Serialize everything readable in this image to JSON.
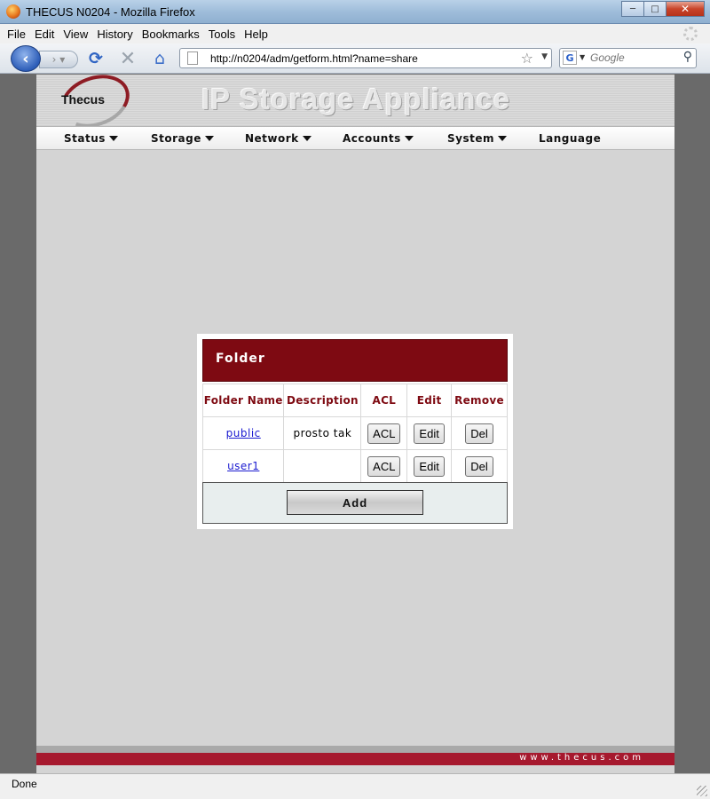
{
  "window": {
    "title": "THECUS N0204 - Mozilla Firefox",
    "controls": {
      "minimize": "─",
      "maximize": "□",
      "close": "✕"
    }
  },
  "menubar": [
    "File",
    "Edit",
    "View",
    "History",
    "Bookmarks",
    "Tools",
    "Help"
  ],
  "navbar": {
    "back_glyph": "‹",
    "forward_glyph": "› ▾",
    "url": "http://n0204/adm/getform.html?name=share",
    "search_placeholder": "Google",
    "search_engine_glyph": "G",
    "icons": [
      "back-arrow-icon",
      "forward-arrow-icon",
      "reload-icon",
      "stop-icon",
      "home-icon",
      "page-icon",
      "bookmark-star-icon",
      "search-icon"
    ]
  },
  "banner": {
    "logo_text": "Thecus",
    "title": "IP Storage Appliance"
  },
  "mainnav": [
    {
      "label": "Status",
      "caret": true
    },
    {
      "label": "Storage",
      "caret": true
    },
    {
      "label": "Network",
      "caret": true
    },
    {
      "label": "Accounts",
      "caret": true
    },
    {
      "label": "System",
      "caret": true
    },
    {
      "label": "Language",
      "caret": false
    }
  ],
  "folder_panel": {
    "title": "Folder",
    "columns": [
      "Folder Name",
      "Description",
      "ACL",
      "Edit",
      "Remove"
    ],
    "rows": [
      {
        "name": "public",
        "description": "prosto tak",
        "acl": "ACL",
        "edit": "Edit",
        "remove": "Del"
      },
      {
        "name": "user1",
        "description": "",
        "acl": "ACL",
        "edit": "Edit",
        "remove": "Del"
      }
    ],
    "add_label": "Add"
  },
  "footer": {
    "url": "www.thecus.com"
  },
  "status": {
    "text": "Done"
  },
  "colors": {
    "accent": "#7e0a12",
    "footer": "#a6192e",
    "page_bg": "#d4d4d4"
  }
}
